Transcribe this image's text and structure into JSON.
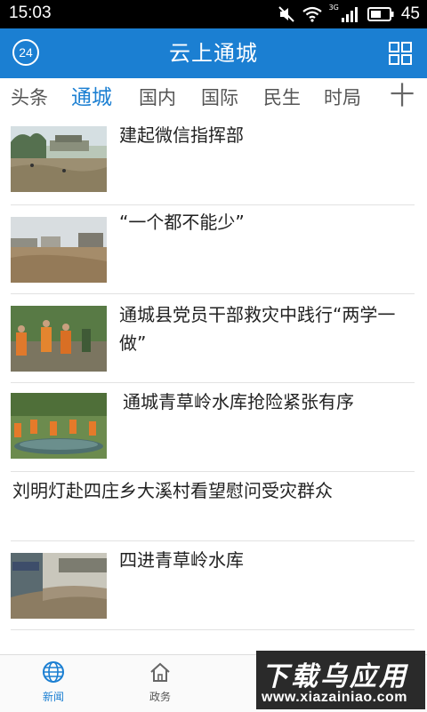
{
  "status_bar": {
    "time": "15:03",
    "network": "3G",
    "battery": "45"
  },
  "app_bar": {
    "badge": "24",
    "title": "云上通城"
  },
  "tabs": [
    "头条",
    "通城",
    "国内",
    "国际",
    "民生",
    "时局"
  ],
  "tabs_more": "十",
  "active_tab": "通城",
  "news": [
    {
      "title": "建起微信指挥部",
      "has_image": true
    },
    {
      "title": "“一个都不能少”",
      "has_image": true
    },
    {
      "title": "通城县党员干部救灾中践行“两学一做”",
      "has_image": true
    },
    {
      "title": "通城青草岭水库抢险紧张有序",
      "has_image": true
    },
    {
      "title": "刘明灯赴四庄乡大溪村看望慰问受灾群众",
      "has_image": false
    },
    {
      "title": "四进青草岭水库",
      "has_image": true
    }
  ],
  "bottom_nav": [
    {
      "label": "新闻",
      "icon": "globe-icon",
      "active": true
    },
    {
      "label": "政务",
      "icon": "home-icon",
      "active": false
    }
  ],
  "watermark": {
    "line1": "下载乌应用",
    "line2": "www.xiazainiao.com"
  },
  "colors": {
    "primary": "#1b7fd2",
    "text": "#222222",
    "divider": "#e2e2e2"
  }
}
